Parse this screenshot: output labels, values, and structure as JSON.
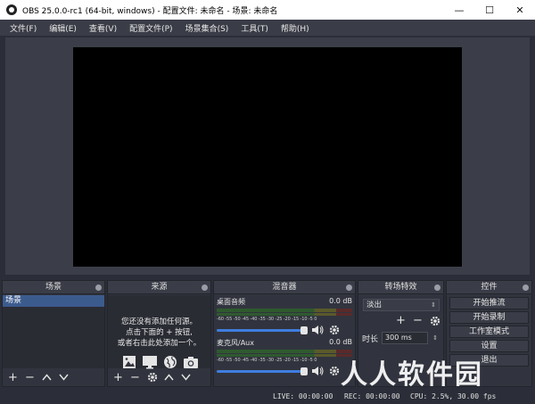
{
  "window": {
    "title": "OBS 25.0.0-rc1 (64-bit, windows) - 配置文件: 未命名 - 场景: 未命名",
    "minimize": "—",
    "maximize": "☐",
    "close": "✕"
  },
  "menu": [
    "文件(F)",
    "编辑(E)",
    "查看(V)",
    "配置文件(P)",
    "场景集合(S)",
    "工具(T)",
    "帮助(H)"
  ],
  "docks": {
    "scenes": {
      "title": "场景",
      "items": [
        "场景"
      ]
    },
    "sources": {
      "title": "来源",
      "hint_line1": "您还没有添加任何源。",
      "hint_line2": "点击下面的 + 按钮,",
      "hint_line3": "或者右击此处添加一个。"
    },
    "mixer": {
      "title": "混音器",
      "channels": [
        {
          "name": "桌面音频",
          "db": "0.0 dB",
          "level": 1.0
        },
        {
          "name": "麦克风/Aux",
          "db": "0.0 dB",
          "level": 1.0
        }
      ],
      "ticks": "-60 -55 -50 -45 -40 -35 -30 -25 -20 -15 -10 -5 0"
    },
    "transitions": {
      "title": "转场特效",
      "selected": "淡出",
      "duration_label": "时长",
      "duration_value": "300 ms"
    },
    "controls": {
      "title": "控件",
      "buttons": [
        "开始推流",
        "开始录制",
        "工作室模式",
        "设置",
        "退出"
      ]
    }
  },
  "status": {
    "live": "LIVE: 00:00:00",
    "rec": "REC: 00:00:00",
    "cpu": "CPU: 2.5%, 30.00 fps"
  },
  "watermark": "人人软件园",
  "colors": {
    "background": "#2b2e38",
    "selected_scene": "#3c5b8d",
    "volume_slider": "#3f7de0"
  }
}
